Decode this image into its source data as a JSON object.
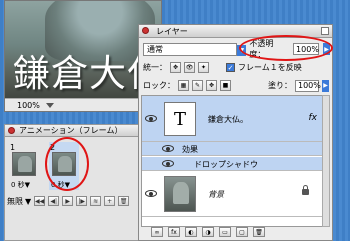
{
  "document": {
    "image_text": "鎌倉大仏",
    "zoom": "100%"
  },
  "animation_palette": {
    "title": "アニメーション（フレーム）",
    "frames": [
      {
        "number": "1",
        "delay": "0 秒▼"
      },
      {
        "number": "2",
        "delay": "0 秒▼"
      }
    ],
    "loop": "無限",
    "controls": [
      "◀◀",
      "◀|",
      "◀",
      "▶",
      "|▶",
      "≋",
      "+",
      "🗑"
    ]
  },
  "layers_palette": {
    "title": "レイヤー",
    "blend_mode": "通常",
    "opacity_label": "不透明度：",
    "opacity_value": "100%",
    "unify_label": "統一：",
    "propagate_label": "フレーム１を反映",
    "lock_label": "ロック：",
    "fill_label": "塗り：",
    "fill_value": "100%",
    "layers": [
      {
        "name": "鎌倉大仏。",
        "thumb": "T",
        "fx": "fx"
      },
      {
        "name": "効果"
      },
      {
        "name": "ドロップシャドウ"
      },
      {
        "name": "背景"
      }
    ],
    "footer_buttons": [
      "∞",
      "fx",
      "◐",
      "◑",
      "▭",
      "▢",
      "🗑"
    ]
  },
  "colors": {
    "selection": "#bed4f2",
    "accent": "#3b7ad9",
    "annotation_red": "#e01515"
  }
}
